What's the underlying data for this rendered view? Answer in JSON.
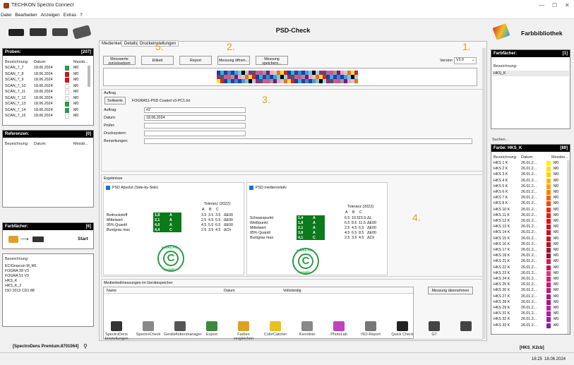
{
  "window": {
    "title": "TECHKON Spectro Connect",
    "min": "—",
    "max": "☐",
    "close": "✕"
  },
  "menu": [
    "Datei",
    "Bearbeiten",
    "Anzeigen",
    "Extras",
    "?"
  ],
  "left": {
    "probes": {
      "title": "Proben:",
      "count": "[207]",
      "cols": [
        "Bezeichnung:",
        "Datum:",
        "Messb..."
      ],
      "rows": [
        {
          "name": "SCAN_7_7",
          "date": "18.06.2024",
          "color": "#2e9a4a",
          "m": "M0"
        },
        {
          "name": "SCAN_7_8",
          "date": "18.06.2024",
          "color": "#c81818",
          "m": "M0"
        },
        {
          "name": "SCAN_7_9",
          "date": "18.06.2024",
          "color": "#c81818",
          "m": "M0"
        },
        {
          "name": "SCAN_7_10",
          "date": "18.06.2024",
          "color": "#ffffff",
          "m": "M0"
        },
        {
          "name": "SCAN_7_11",
          "date": "18.06.2024",
          "color": "#ffffff",
          "m": "M0"
        },
        {
          "name": "SCAN_7_12",
          "date": "18.06.2024",
          "color": "#ffffff",
          "m": "M0"
        },
        {
          "name": "SCAN_7_13",
          "date": "18.06.2024",
          "color": "#2e9a4a",
          "m": "M0"
        },
        {
          "name": "SCAN_7_14",
          "date": "18.06.2024",
          "color": "#2e9a4a",
          "m": "M0"
        },
        {
          "name": "SCAN_7_15",
          "date": "18.06.2024",
          "color": "#ffffff",
          "m": "M0"
        }
      ]
    },
    "references": {
      "title": "Referenzen:",
      "count": "[0]",
      "cols": [
        "Bezeichnung:",
        "Datum:",
        "Messb..."
      ]
    },
    "farb": {
      "title": "Farbfächer:",
      "count": "[6]",
      "start": "Start",
      "col": "Bezeichnung:",
      "items": [
        "ECIGravcon M_M1",
        "FOGRA 39 V3",
        "FOGRA 51 V3",
        "HKS_K",
        "HKS_K_2",
        "ISO 2013 CD1 88"
      ]
    },
    "footer": "[SpectroDens Premium.8701064]"
  },
  "center": {
    "title": "PSD-Check",
    "tabs": [
      "Medienkeil",
      "Details",
      "Druckeinstellungen"
    ],
    "buttons": {
      "reset": "Messwerte\nzurücksetzen",
      "etikett": "Etikett",
      "report": "Report",
      "open": "Messung öffnen...",
      "save": "Messung\nspeichern..."
    },
    "version_label": "Version",
    "version": "V3.0",
    "numbers": [
      "5.",
      "2.",
      "1.",
      "3.",
      "4."
    ],
    "auftrag": {
      "group": "Auftrag",
      "sollwerte_btn": "Sollwerte",
      "sollwerte_file": "FOGRA51-PSD Coated v3-PC1.txt",
      "fields": [
        {
          "label": "Auftrag:",
          "value": "#2"
        },
        {
          "label": "Datum:",
          "value": "18.06.2024"
        },
        {
          "label": "Prüfer:",
          "value": ""
        },
        {
          "label": "Drucksystem:",
          "value": ""
        },
        {
          "label": "Bemerkungen:",
          "value": ""
        }
      ]
    },
    "results": {
      "group": "Ergebnisse",
      "left": {
        "title": "PSD Absolut (Side-by-Side)",
        "tol": "Toleranz (2022):",
        "abc": [
          "A",
          "B",
          "C"
        ],
        "rows": [
          {
            "label": "Bedruckstoff",
            "val": "1,8",
            "grade": "A",
            "a": "3.5",
            "b": "3.5",
            "c": "3.5",
            "u": "ΔE00"
          },
          {
            "label": "Mittelwert",
            "val": "2,1",
            "grade": "A",
            "a": "2.5",
            "b": "4.5",
            "c": "5.5",
            "u": "ΔE00"
          },
          {
            "label": "95% Quantil",
            "val": "4,0",
            "grade": "A",
            "a": "4.5",
            "b": "5.5",
            "c": "6.5",
            "u": "ΔE00"
          },
          {
            "label": "Buntgrau max",
            "val": "4,4",
            "grade": "C",
            "a": "2.5",
            "b": "3.5",
            "c": "4.5",
            "u": "ΔCh"
          }
        ]
      },
      "right": {
        "title": "PSD medienrelativ",
        "tol": "Toleranz (2022):",
        "abc": [
          "A",
          "B",
          "C"
        ],
        "rows": [
          {
            "label": "Schwarzpunkt",
            "val": "1,4",
            "grade": "A",
            "a": "6.5",
            "b": "10.5",
            "c": "15.5",
            "u": "ΔL"
          },
          {
            "label": "Weißpunkt",
            "val": "1,8",
            "grade": "A",
            "a": "6.5",
            "b": "8.5",
            "c": "11.5",
            "u": "ΔE00"
          },
          {
            "label": "Mittelwert",
            "val": "2,1",
            "grade": "A",
            "a": "2.5",
            "b": "4.5",
            "c": "6.5",
            "u": "ΔE00"
          },
          {
            "label": "95% Quantil",
            "val": "3,8",
            "grade": "A",
            "a": "4.5",
            "b": "6.5",
            "c": "8.5",
            "u": "ΔE00"
          },
          {
            "label": "Buntgrau max",
            "val": "4,1",
            "grade": "C",
            "a": "2.5",
            "b": "3.5",
            "c": "4.5",
            "u": "ΔCh"
          }
        ]
      },
      "stamp_top": "FOGRA PSD",
      "stamp_bottom": "PASSED",
      "stamp_letter": "C"
    },
    "mediastore": {
      "group": "Medienkeilmessungen im Gerätespeicher",
      "cols": [
        "Name",
        "Datum",
        "Vollständig"
      ],
      "take_btn": "Messung übernehmen"
    }
  },
  "toolbar": [
    {
      "label": "SpectroDens Einstellungen",
      "icon": "device-icon",
      "color": "#333"
    },
    {
      "label": "SpectroCheck",
      "icon": "pen-icon",
      "color": "#888"
    },
    {
      "label": "Geräteflottenmanager",
      "icon": "fleet-icon",
      "color": "#555"
    },
    {
      "label": "Export",
      "icon": "export-icon",
      "color": "#3a8a3a"
    },
    {
      "label": "Farben vergleichen",
      "icon": "compare-icon",
      "color": "#e0a020"
    },
    {
      "label": "ColorCatcher",
      "icon": "catcher-icon",
      "color": "#e8c020"
    },
    {
      "label": "Kennlinie",
      "icon": "curve-icon",
      "color": "#888"
    },
    {
      "label": "PhotoLab",
      "icon": "photolab-icon",
      "color": "#c040c0"
    },
    {
      "label": "ISO-Report",
      "icon": "iso-icon",
      "color": "#777"
    },
    {
      "label": "Quick Check",
      "icon": "house-icon",
      "color": "#222"
    },
    {
      "label": "G7",
      "icon": "g7-icon",
      "color": "#444"
    },
    {
      "label": "",
      "icon": "more-icon",
      "color": "#444"
    }
  ],
  "right": {
    "title": "Farbbibliothek",
    "farb": {
      "title": "Farbfächer:",
      "count": "[1]",
      "col": "Bezeichnung:",
      "item": "HKS_K"
    },
    "search": "Suchen...",
    "colors": {
      "title": "Farbe: HKS_K",
      "count": "[89]",
      "cols": [
        "Bezeichnung:",
        "Datum:",
        "Messbe..."
      ],
      "rows": [
        {
          "n": "HKS 1 K",
          "d": "26.01.2...",
          "c": "#fff200"
        },
        {
          "n": "HKS 2 K",
          "d": "26.01.2...",
          "c": "#ffe000"
        },
        {
          "n": "HKS 3 K",
          "d": "26.01.2...",
          "c": "#ffd000"
        },
        {
          "n": "HKS 4 K",
          "d": "26.01.2...",
          "c": "#ffb800"
        },
        {
          "n": "HKS 5 K",
          "d": "26.01.2...",
          "c": "#ffa000"
        },
        {
          "n": "HKS 6 K",
          "d": "26.01.2...",
          "c": "#ff8000"
        },
        {
          "n": "HKS 7 K",
          "d": "26.01.2...",
          "c": "#f56000"
        },
        {
          "n": "HKS 8 K",
          "d": "26.01.2...",
          "c": "#ee4a00"
        },
        {
          "n": "HKS 10 K",
          "d": "26.01.2...",
          "c": "#e83010"
        },
        {
          "n": "HKS 11 K",
          "d": "26.01.2...",
          "c": "#e22010"
        },
        {
          "n": "HKS 12 K",
          "d": "26.01.2...",
          "c": "#d81818"
        },
        {
          "n": "HKS 13 K",
          "d": "26.01.2...",
          "c": "#d01020"
        },
        {
          "n": "HKS 14 K",
          "d": "26.01.2...",
          "c": "#c81020"
        },
        {
          "n": "HKS 15 K",
          "d": "26.01.2...",
          "c": "#c01828"
        },
        {
          "n": "HKS 16 K",
          "d": "26.01.2...",
          "c": "#b01828"
        },
        {
          "n": "HKS 17 K",
          "d": "26.01.2...",
          "c": "#a01830"
        },
        {
          "n": "HKS 18 K",
          "d": "26.01.2...",
          "c": "#8a1830"
        },
        {
          "n": "HKS 21 K",
          "d": "26.01.2...",
          "c": "#e01860"
        },
        {
          "n": "HKS 22 K",
          "d": "26.01.2...",
          "c": "#d01050"
        },
        {
          "n": "HKS 23 K",
          "d": "26.01.2...",
          "c": "#e03878"
        },
        {
          "n": "HKS 24 K",
          "d": "26.01.2...",
          "c": "#d02070"
        },
        {
          "n": "HKS 25 K",
          "d": "26.01.2...",
          "c": "#c81878"
        },
        {
          "n": "HKS 26 K",
          "d": "26.01.2...",
          "c": "#c01880"
        },
        {
          "n": "HKS 27 K",
          "d": "26.01.2...",
          "c": "#b01888"
        },
        {
          "n": "HKS 28 K",
          "d": "26.01.2...",
          "c": "#a01880"
        },
        {
          "n": "HKS 29 K",
          "d": "26.01.2...",
          "c": "#c82098"
        },
        {
          "n": "HKS 31 K",
          "d": "26.01.2...",
          "c": "#b020a0"
        },
        {
          "n": "HKS 32 K",
          "d": "26.01.2...",
          "c": "#9820a8"
        },
        {
          "n": "HKS 33 K",
          "d": "26.01.2...",
          "c": "#8820a8"
        }
      ]
    },
    "footer": "[HKS_K2cb]"
  },
  "status": {
    "time": "16:25",
    "date": "18.06.2024"
  }
}
